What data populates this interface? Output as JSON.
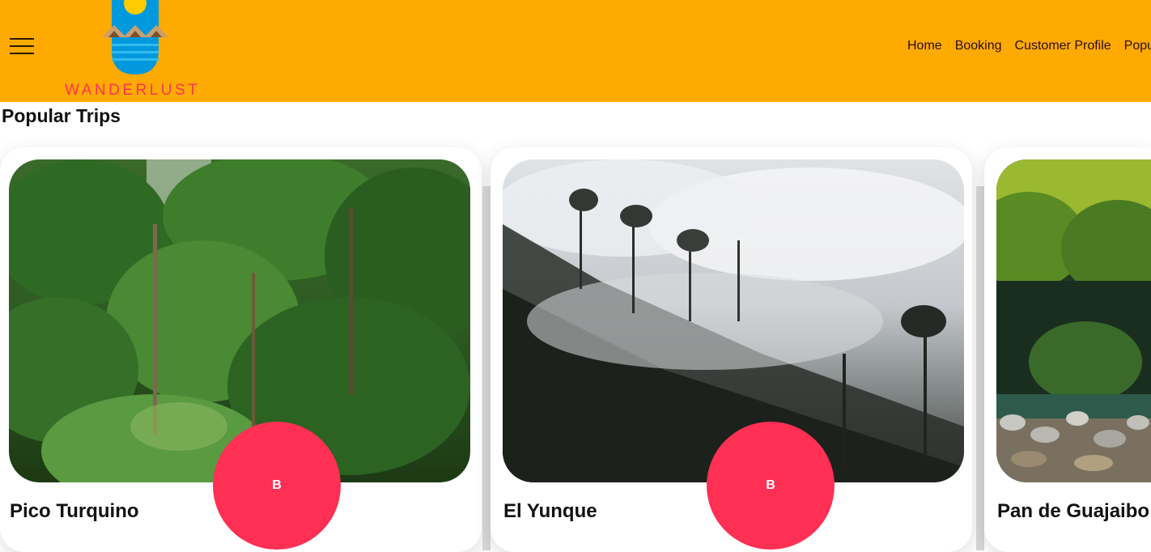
{
  "header": {
    "logo_text": "WANDERLUST",
    "nav": [
      "Home",
      "Booking",
      "Customer Profile",
      "Popul"
    ]
  },
  "section": {
    "title": "Popular Trips"
  },
  "cards": [
    {
      "title": "Pico Turquino",
      "badge": "B"
    },
    {
      "title": "El Yunque",
      "badge": "B"
    },
    {
      "title": "Pan de Guajaibo"
    }
  ],
  "colors": {
    "header_bg": "#ffaa00",
    "badge_bg": "#ff3054",
    "logo_text": "#ff3355",
    "logo_blue": "#0099dd"
  }
}
